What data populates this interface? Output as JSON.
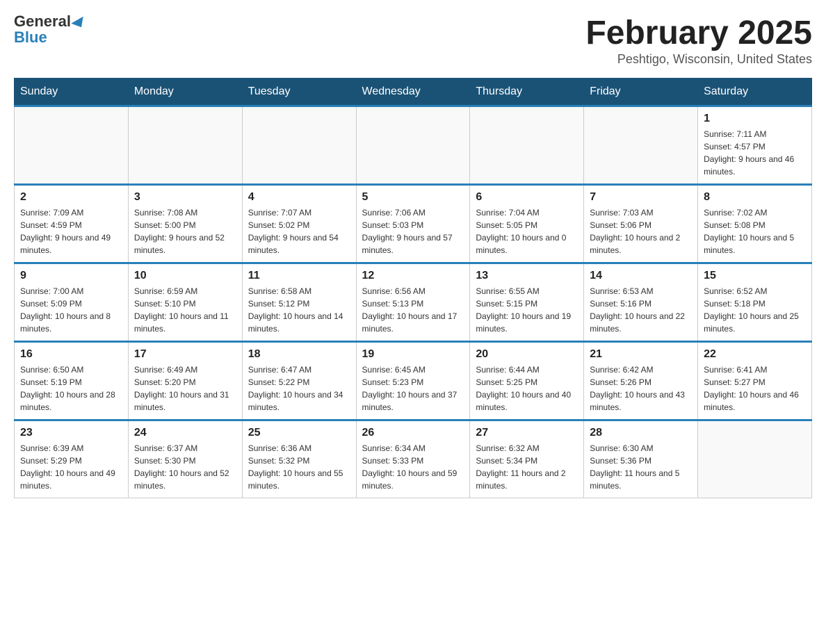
{
  "header": {
    "logo_general": "General",
    "logo_blue": "Blue",
    "title": "February 2025",
    "subtitle": "Peshtigo, Wisconsin, United States"
  },
  "days_of_week": [
    "Sunday",
    "Monday",
    "Tuesday",
    "Wednesday",
    "Thursday",
    "Friday",
    "Saturday"
  ],
  "weeks": [
    [
      {
        "day": "",
        "sunrise": "",
        "sunset": "",
        "daylight": ""
      },
      {
        "day": "",
        "sunrise": "",
        "sunset": "",
        "daylight": ""
      },
      {
        "day": "",
        "sunrise": "",
        "sunset": "",
        "daylight": ""
      },
      {
        "day": "",
        "sunrise": "",
        "sunset": "",
        "daylight": ""
      },
      {
        "day": "",
        "sunrise": "",
        "sunset": "",
        "daylight": ""
      },
      {
        "day": "",
        "sunrise": "",
        "sunset": "",
        "daylight": ""
      },
      {
        "day": "1",
        "sunrise": "Sunrise: 7:11 AM",
        "sunset": "Sunset: 4:57 PM",
        "daylight": "Daylight: 9 hours and 46 minutes."
      }
    ],
    [
      {
        "day": "2",
        "sunrise": "Sunrise: 7:09 AM",
        "sunset": "Sunset: 4:59 PM",
        "daylight": "Daylight: 9 hours and 49 minutes."
      },
      {
        "day": "3",
        "sunrise": "Sunrise: 7:08 AM",
        "sunset": "Sunset: 5:00 PM",
        "daylight": "Daylight: 9 hours and 52 minutes."
      },
      {
        "day": "4",
        "sunrise": "Sunrise: 7:07 AM",
        "sunset": "Sunset: 5:02 PM",
        "daylight": "Daylight: 9 hours and 54 minutes."
      },
      {
        "day": "5",
        "sunrise": "Sunrise: 7:06 AM",
        "sunset": "Sunset: 5:03 PM",
        "daylight": "Daylight: 9 hours and 57 minutes."
      },
      {
        "day": "6",
        "sunrise": "Sunrise: 7:04 AM",
        "sunset": "Sunset: 5:05 PM",
        "daylight": "Daylight: 10 hours and 0 minutes."
      },
      {
        "day": "7",
        "sunrise": "Sunrise: 7:03 AM",
        "sunset": "Sunset: 5:06 PM",
        "daylight": "Daylight: 10 hours and 2 minutes."
      },
      {
        "day": "8",
        "sunrise": "Sunrise: 7:02 AM",
        "sunset": "Sunset: 5:08 PM",
        "daylight": "Daylight: 10 hours and 5 minutes."
      }
    ],
    [
      {
        "day": "9",
        "sunrise": "Sunrise: 7:00 AM",
        "sunset": "Sunset: 5:09 PM",
        "daylight": "Daylight: 10 hours and 8 minutes."
      },
      {
        "day": "10",
        "sunrise": "Sunrise: 6:59 AM",
        "sunset": "Sunset: 5:10 PM",
        "daylight": "Daylight: 10 hours and 11 minutes."
      },
      {
        "day": "11",
        "sunrise": "Sunrise: 6:58 AM",
        "sunset": "Sunset: 5:12 PM",
        "daylight": "Daylight: 10 hours and 14 minutes."
      },
      {
        "day": "12",
        "sunrise": "Sunrise: 6:56 AM",
        "sunset": "Sunset: 5:13 PM",
        "daylight": "Daylight: 10 hours and 17 minutes."
      },
      {
        "day": "13",
        "sunrise": "Sunrise: 6:55 AM",
        "sunset": "Sunset: 5:15 PM",
        "daylight": "Daylight: 10 hours and 19 minutes."
      },
      {
        "day": "14",
        "sunrise": "Sunrise: 6:53 AM",
        "sunset": "Sunset: 5:16 PM",
        "daylight": "Daylight: 10 hours and 22 minutes."
      },
      {
        "day": "15",
        "sunrise": "Sunrise: 6:52 AM",
        "sunset": "Sunset: 5:18 PM",
        "daylight": "Daylight: 10 hours and 25 minutes."
      }
    ],
    [
      {
        "day": "16",
        "sunrise": "Sunrise: 6:50 AM",
        "sunset": "Sunset: 5:19 PM",
        "daylight": "Daylight: 10 hours and 28 minutes."
      },
      {
        "day": "17",
        "sunrise": "Sunrise: 6:49 AM",
        "sunset": "Sunset: 5:20 PM",
        "daylight": "Daylight: 10 hours and 31 minutes."
      },
      {
        "day": "18",
        "sunrise": "Sunrise: 6:47 AM",
        "sunset": "Sunset: 5:22 PM",
        "daylight": "Daylight: 10 hours and 34 minutes."
      },
      {
        "day": "19",
        "sunrise": "Sunrise: 6:45 AM",
        "sunset": "Sunset: 5:23 PM",
        "daylight": "Daylight: 10 hours and 37 minutes."
      },
      {
        "day": "20",
        "sunrise": "Sunrise: 6:44 AM",
        "sunset": "Sunset: 5:25 PM",
        "daylight": "Daylight: 10 hours and 40 minutes."
      },
      {
        "day": "21",
        "sunrise": "Sunrise: 6:42 AM",
        "sunset": "Sunset: 5:26 PM",
        "daylight": "Daylight: 10 hours and 43 minutes."
      },
      {
        "day": "22",
        "sunrise": "Sunrise: 6:41 AM",
        "sunset": "Sunset: 5:27 PM",
        "daylight": "Daylight: 10 hours and 46 minutes."
      }
    ],
    [
      {
        "day": "23",
        "sunrise": "Sunrise: 6:39 AM",
        "sunset": "Sunset: 5:29 PM",
        "daylight": "Daylight: 10 hours and 49 minutes."
      },
      {
        "day": "24",
        "sunrise": "Sunrise: 6:37 AM",
        "sunset": "Sunset: 5:30 PM",
        "daylight": "Daylight: 10 hours and 52 minutes."
      },
      {
        "day": "25",
        "sunrise": "Sunrise: 6:36 AM",
        "sunset": "Sunset: 5:32 PM",
        "daylight": "Daylight: 10 hours and 55 minutes."
      },
      {
        "day": "26",
        "sunrise": "Sunrise: 6:34 AM",
        "sunset": "Sunset: 5:33 PM",
        "daylight": "Daylight: 10 hours and 59 minutes."
      },
      {
        "day": "27",
        "sunrise": "Sunrise: 6:32 AM",
        "sunset": "Sunset: 5:34 PM",
        "daylight": "Daylight: 11 hours and 2 minutes."
      },
      {
        "day": "28",
        "sunrise": "Sunrise: 6:30 AM",
        "sunset": "Sunset: 5:36 PM",
        "daylight": "Daylight: 11 hours and 5 minutes."
      },
      {
        "day": "",
        "sunrise": "",
        "sunset": "",
        "daylight": ""
      }
    ]
  ]
}
